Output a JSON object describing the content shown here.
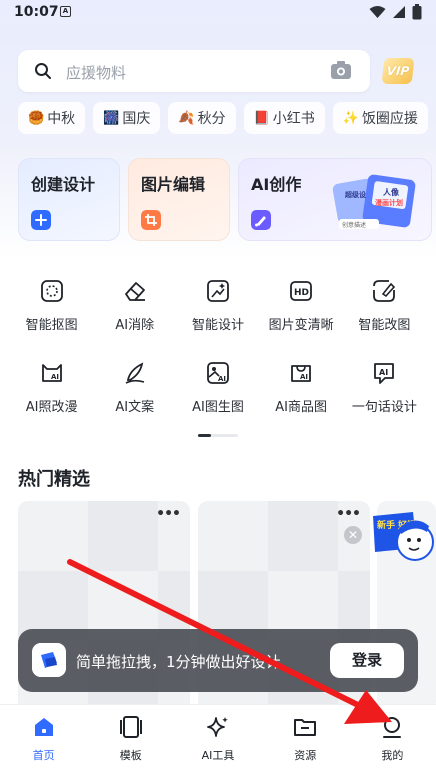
{
  "status_bar": {
    "time": "10:07",
    "app_indicator": "A"
  },
  "search": {
    "placeholder": "应援物料",
    "vip_label": "VIP"
  },
  "tags": [
    {
      "emoji": "🥮",
      "label": "中秋"
    },
    {
      "emoji": "🎆",
      "label": "国庆"
    },
    {
      "emoji": "🍂",
      "label": "秋分"
    },
    {
      "emoji": "📕",
      "label": "小红书"
    },
    {
      "emoji": "✨",
      "label": "饭圈应援"
    },
    {
      "emoji": "🏆",
      "label": ""
    }
  ],
  "cards": {
    "create": {
      "title": "创建设计",
      "accent": "#2f6bff"
    },
    "edit": {
      "title": "图片编辑",
      "accent": "#ff7a45"
    },
    "ai": {
      "title": "AI创作",
      "accent": "#6b5cff",
      "illustration_lines": [
        "超级设",
        "人像",
        "漫画计划",
        "创意描述"
      ]
    }
  },
  "tools": [
    [
      {
        "icon": "cutout-icon",
        "label": "智能抠图"
      },
      {
        "icon": "eraser-icon",
        "label": "AI消除"
      },
      {
        "icon": "smart-design-icon",
        "label": "智能设计"
      },
      {
        "icon": "hd-icon",
        "label": "图片变清晰"
      },
      {
        "icon": "modify-image-icon",
        "label": "智能改图"
      }
    ],
    [
      {
        "icon": "ai-cartoon-icon",
        "label": "AI照改漫"
      },
      {
        "icon": "pen-icon",
        "label": "AI文案"
      },
      {
        "icon": "ai-image-icon",
        "label": "AI图生图"
      },
      {
        "icon": "ai-product-icon",
        "label": "AI商品图"
      },
      {
        "icon": "ai-sentence-icon",
        "label": "一句话设计"
      }
    ]
  ],
  "hot": {
    "title": "热门精选",
    "more_label": "•••",
    "mascot_label": "新手 好福"
  },
  "toast": {
    "text": "简单拖拉拽，1分钟做出好设计",
    "button": "登录"
  },
  "nav": [
    {
      "icon": "home-icon",
      "label": "首页",
      "active": true
    },
    {
      "icon": "template-icon",
      "label": "模板",
      "active": false
    },
    {
      "icon": "ai-tools-icon",
      "label": "AI工具",
      "active": false
    },
    {
      "icon": "folder-icon",
      "label": "资源",
      "active": false
    },
    {
      "icon": "profile-icon",
      "label": "我的",
      "active": false
    }
  ],
  "colors": {
    "primary": "#2f6bff",
    "annotation_arrow": "#ee1c1c"
  }
}
